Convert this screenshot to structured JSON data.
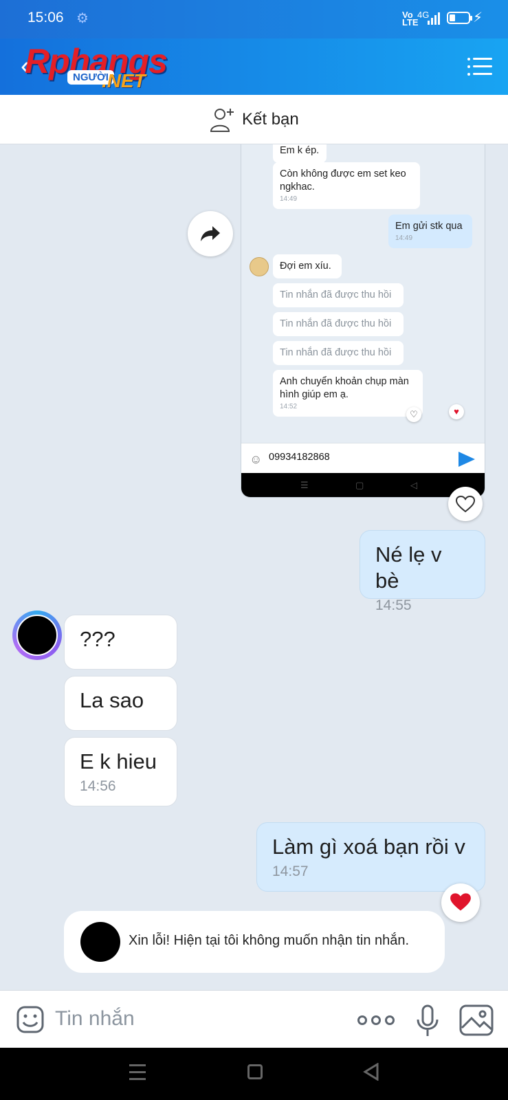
{
  "status_bar": {
    "time": "15:06",
    "network": "Vo LTE",
    "signal_label": "4G"
  },
  "header": {
    "logo_main": "Rphangs",
    "logo_tag": "NGƯỜI",
    "logo_suffix": ".NET"
  },
  "friend_bar": {
    "label": "Kết bạn"
  },
  "forwarded_screenshot": {
    "messages": [
      {
        "text": "Em k ép.",
        "time": "",
        "mine": false
      },
      {
        "text": "Còn không được em set keo ngkhac.",
        "time": "14:49",
        "mine": false
      },
      {
        "text": "Em gửi stk qua",
        "time": "14:49",
        "mine": true
      },
      {
        "text": "Đợi em xíu.",
        "time": "",
        "mine": false
      },
      {
        "text": "Tin nhắn đã được thu hồi",
        "time": "",
        "mine": false
      },
      {
        "text": "Tin nhắn đã được thu hồi",
        "time": "",
        "mine": false
      },
      {
        "text": "Tin nhắn đã được thu hồi",
        "time": "",
        "mine": false
      },
      {
        "text": "Anh chuyển khoản chụp màn hình giúp em ạ.",
        "time": "14:52",
        "mine": false
      }
    ],
    "input_value": "09934182868"
  },
  "messages": [
    {
      "text": "Né lẹ v bè",
      "time": "14:55",
      "mine": true
    },
    {
      "text": "???",
      "time": "",
      "mine": false
    },
    {
      "text": "La sao",
      "time": "",
      "mine": false
    },
    {
      "text": "E k hieu",
      "time": "14:56",
      "mine": false
    },
    {
      "text": "Làm gì xoá bạn rồi v",
      "time": "14:57",
      "mine": true
    }
  ],
  "notice": {
    "text": "Xin lỗi! Hiện tại tôi không muốn nhận tin nhắn."
  },
  "composer": {
    "placeholder": "Tin nhắn"
  },
  "colors": {
    "header_start": "#1470dc",
    "header_end": "#18a4f2",
    "mine_bubble": "#d6ebfd",
    "background": "#e2e9f1",
    "heart": "#e0142c"
  }
}
